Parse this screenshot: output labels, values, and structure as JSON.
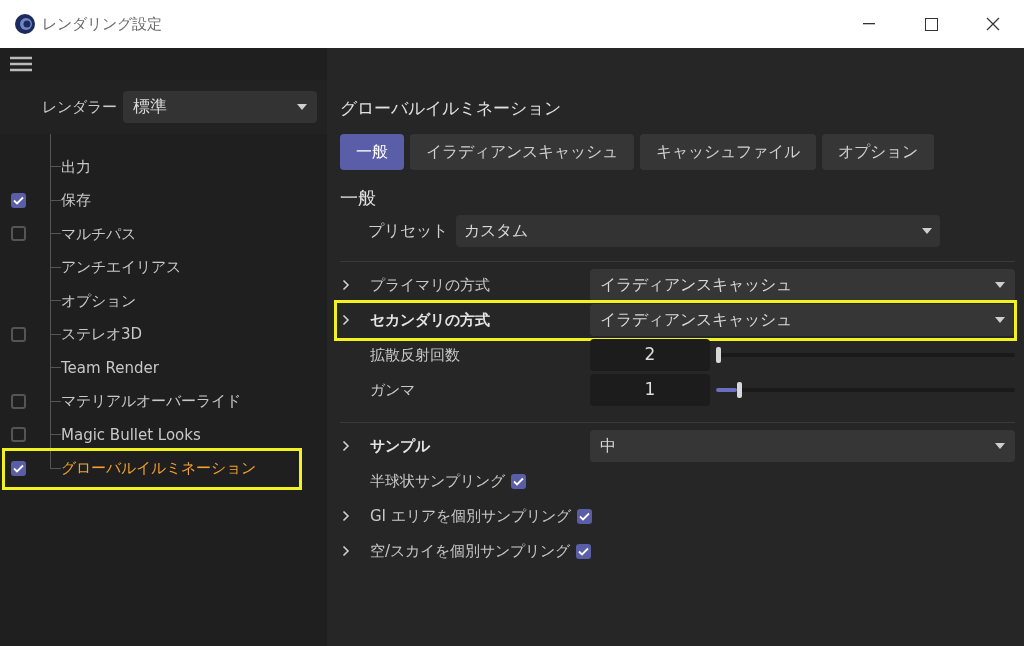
{
  "window": {
    "title": "レンダリング設定"
  },
  "renderer": {
    "label": "レンダラー",
    "value": "標準"
  },
  "sidebar": {
    "items": [
      {
        "label": "出力",
        "kind": "plain",
        "selected": false,
        "highlighted": false
      },
      {
        "label": "保存",
        "kind": "check",
        "checked": true,
        "selected": false,
        "highlighted": false
      },
      {
        "label": "マルチパス",
        "kind": "check",
        "checked": false,
        "selected": false,
        "highlighted": false
      },
      {
        "label": "アンチエイリアス",
        "kind": "plain",
        "selected": false,
        "highlighted": false
      },
      {
        "label": "オプション",
        "kind": "plain",
        "selected": false,
        "highlighted": false
      },
      {
        "label": "ステレオ3D",
        "kind": "check",
        "checked": false,
        "selected": false,
        "highlighted": false
      },
      {
        "label": "Team Render",
        "kind": "plain",
        "selected": false,
        "highlighted": false
      },
      {
        "label": "マテリアルオーバーライド",
        "kind": "check",
        "checked": false,
        "selected": false,
        "highlighted": false
      },
      {
        "label": "Magic Bullet Looks",
        "kind": "check",
        "checked": false,
        "selected": false,
        "highlighted": false
      },
      {
        "label": "グローバルイルミネーション",
        "kind": "check",
        "checked": true,
        "selected": true,
        "highlighted": true
      }
    ]
  },
  "panel": {
    "title": "グローバルイルミネーション",
    "tabs": [
      {
        "label": "一般",
        "selected": true
      },
      {
        "label": "イラディアンスキャッシュ",
        "selected": false
      },
      {
        "label": "キャッシュファイル",
        "selected": false
      },
      {
        "label": "オプション",
        "selected": false
      }
    ],
    "section": "一般",
    "preset": {
      "label": "プリセット",
      "value": "カスタム"
    },
    "groups": [
      [
        {
          "kind": "dropdown",
          "label": "プライマリの方式",
          "value": "イラディアンスキャッシュ",
          "expandable": true,
          "bold": false,
          "highlighted": false
        },
        {
          "kind": "dropdown",
          "label": "セカンダリの方式",
          "value": "イラディアンスキャッシュ",
          "expandable": true,
          "bold": true,
          "highlighted": true
        },
        {
          "kind": "slider",
          "label": "拡散反射回数",
          "value": "2",
          "level": 0,
          "expandable": false,
          "bold": false,
          "highlighted": false
        },
        {
          "kind": "slider",
          "label": "ガンマ",
          "value": "1",
          "level": 0.07,
          "expandable": false,
          "bold": false,
          "highlighted": false
        }
      ],
      [
        {
          "kind": "dropdown",
          "label": "サンプル",
          "value": "中",
          "expandable": true,
          "bold": true,
          "highlighted": false
        },
        {
          "kind": "checkbox",
          "label": "半球状サンプリング",
          "checked": true,
          "expandable": false,
          "bold": false,
          "highlighted": false
        },
        {
          "kind": "checkbox",
          "label": "GI エリアを個別サンプリング",
          "checked": true,
          "expandable": true,
          "bold": false,
          "highlighted": false
        },
        {
          "kind": "checkbox",
          "label": "空/スカイを個別サンプリング",
          "checked": true,
          "expandable": true,
          "bold": false,
          "highlighted": false
        }
      ]
    ]
  }
}
